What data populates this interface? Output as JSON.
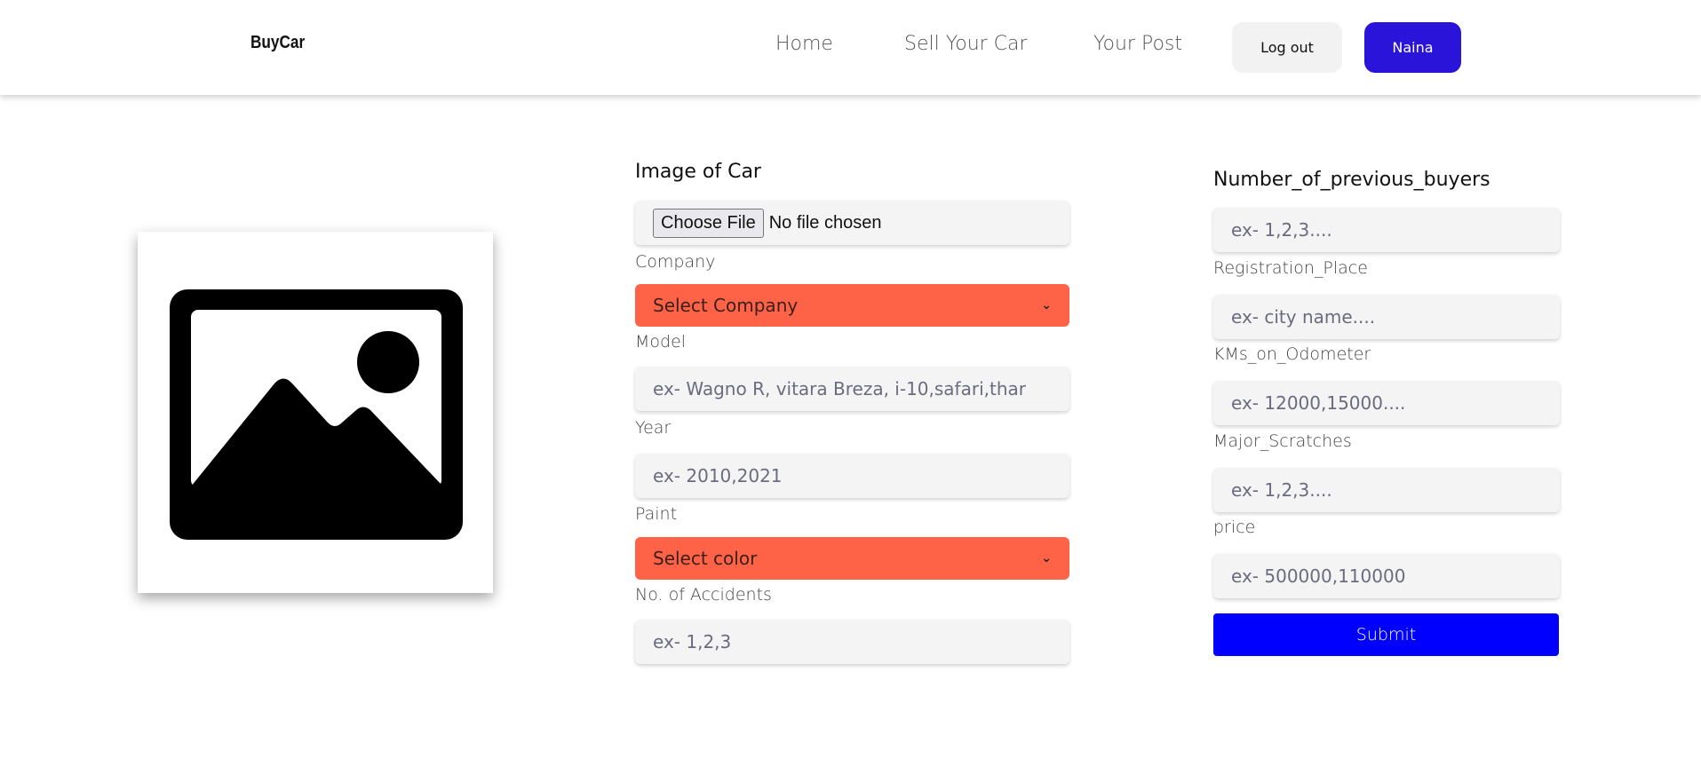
{
  "nav": {
    "brand": "BuyCar",
    "links": [
      "Home",
      "Sell Your Car",
      "Your Post"
    ],
    "logout_label": "Log out",
    "user_label": "Naina",
    "user_color": "#2b14d9"
  },
  "preview": {
    "icon": "image-placeholder-icon"
  },
  "form_left": {
    "image_label": "Image of Car",
    "file_button": "Choose File",
    "file_status": "No file chosen",
    "company_label": "Company",
    "company_select": "Select Company",
    "model_label": "Model",
    "model_placeholder": "ex- Wagno R, vitara Breza, i-10,safari,thar",
    "year_label": "Year",
    "year_placeholder": "ex- 2010,2021",
    "paint_label": "Paint",
    "paint_select": "Select color",
    "accidents_label": "No. of Accidents",
    "accidents_placeholder": "ex- 1,2,3",
    "select_color": "#ff6347"
  },
  "form_right": {
    "buyers_label": "Number_of_previous_buyers",
    "buyers_placeholder": "ex- 1,2,3....",
    "registration_label": "Registration_Place",
    "registration_placeholder": "ex- city name....",
    "kms_label": "KMs_on_Odometer",
    "kms_placeholder": "ex- 12000,15000....",
    "scratches_label": "Major_Scratches",
    "scratches_placeholder": "ex- 1,2,3....",
    "price_label": "price",
    "price_placeholder": "ex- 500000,110000",
    "submit_label": "Submit",
    "submit_color": "#0000ff"
  }
}
